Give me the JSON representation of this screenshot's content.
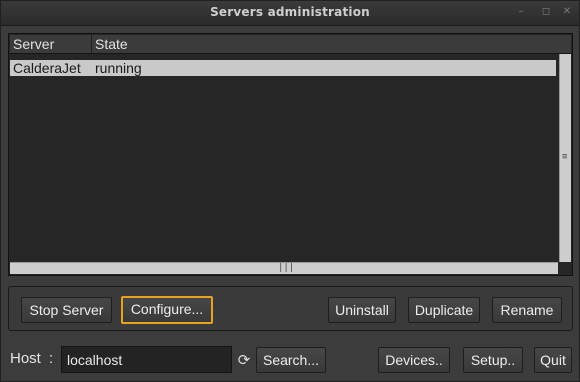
{
  "window": {
    "title": "Servers administration",
    "controls": {
      "minimize": "–",
      "maximize": "◻",
      "close": "✕"
    }
  },
  "table": {
    "columns": [
      "Server",
      "State"
    ],
    "rows": [
      {
        "server": "CalderaJet",
        "state": "running"
      }
    ]
  },
  "server_actions": {
    "stop_server": "Stop Server",
    "configure": "Configure...",
    "uninstall": "Uninstall",
    "duplicate": "Duplicate",
    "rename": "Rename"
  },
  "host": {
    "label": "Host",
    "colon": ":",
    "value": "localhost",
    "search": "Search...",
    "refresh_icon": "⟳"
  },
  "bottom_buttons": {
    "devices": "Devices..",
    "setup": "Setup..",
    "quit": "Quit"
  },
  "colors": {
    "focus_border": "#e8a121",
    "selected_row": "#c9c9c9"
  }
}
